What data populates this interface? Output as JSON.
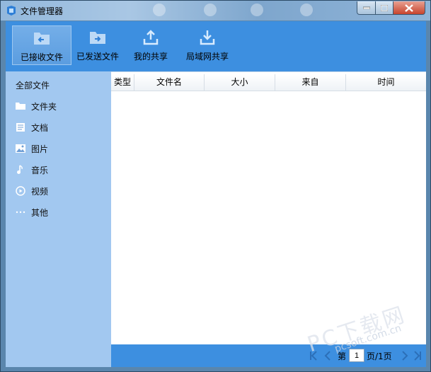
{
  "window": {
    "title": "文件管理器"
  },
  "toolbar": {
    "items": [
      {
        "label": "已接收文件",
        "icon": "folder-receive-icon",
        "active": true
      },
      {
        "label": "已发送文件",
        "icon": "folder-send-icon",
        "active": false
      },
      {
        "label": "我的共享",
        "icon": "upload-share-icon",
        "active": false
      },
      {
        "label": "局域网共享",
        "icon": "download-lan-icon",
        "active": false
      }
    ]
  },
  "sidebar": {
    "all_label": "全部文件",
    "items": [
      {
        "label": "文件夹",
        "icon": "folder-icon"
      },
      {
        "label": "文档",
        "icon": "document-icon"
      },
      {
        "label": "图片",
        "icon": "image-icon"
      },
      {
        "label": "音乐",
        "icon": "music-note-icon"
      },
      {
        "label": "视频",
        "icon": "video-play-icon"
      },
      {
        "label": "其他",
        "icon": "ellipsis-icon"
      }
    ]
  },
  "table": {
    "columns": [
      "类型",
      "文件名",
      "大小",
      "来自",
      "时间"
    ],
    "rows": []
  },
  "pager": {
    "prefix": "第",
    "current_page": "1",
    "suffix": "页/1页"
  },
  "watermark": {
    "text": "PC下载网",
    "url": "pcsoft.com.cn"
  },
  "colors": {
    "toolbar_bg": "#3d8fe0",
    "sidebar_bg": "#a2c8f0",
    "close_button": "#c7442d"
  }
}
